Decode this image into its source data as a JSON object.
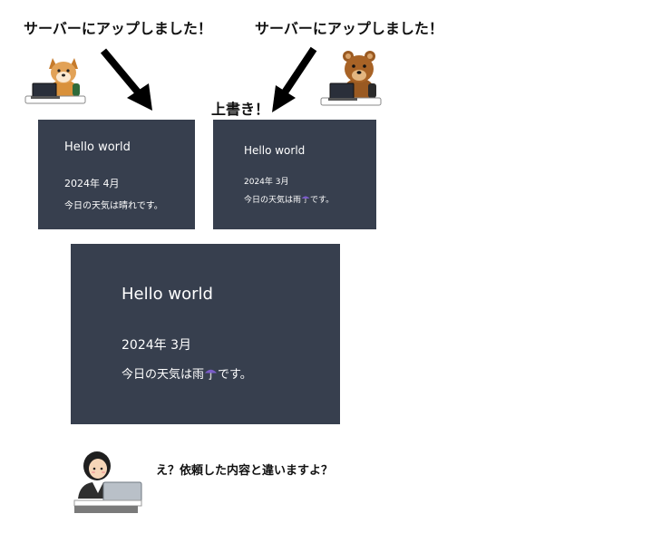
{
  "captions": {
    "dog_upload": "サーバーにアップしました！",
    "bear_upload": "サーバーにアップしました！",
    "overwrite": "上書き！",
    "client_reply": "え？依頼した内容と違いますよ？"
  },
  "panels": {
    "dog": {
      "title": "Hello world",
      "date": "2024年 4月",
      "weather": "今日の天気は晴れです。"
    },
    "bear": {
      "title": "Hello world",
      "date": "2024年 3月",
      "weather_before": "今日の天気は雨",
      "weather_after": "です。"
    },
    "server": {
      "title": "Hello world",
      "date": "2024年 3月",
      "weather_before": "今日の天気は雨",
      "weather_after": "です。"
    }
  },
  "icons": [
    "dog-at-laptop-icon",
    "bear-at-laptop-icon",
    "client-woman-at-laptop-icon",
    "arrow-down-right-icon",
    "arrow-down-left-icon",
    "umbrella-icon"
  ],
  "colors": {
    "panel_background": "#373f4e",
    "panel_text": "#ffffff",
    "caption_text": "#111111"
  }
}
